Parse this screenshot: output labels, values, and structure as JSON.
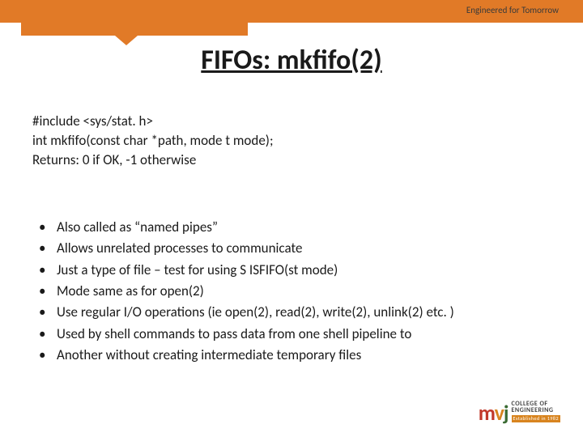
{
  "header": {
    "tagline": "Engineered for Tomorrow"
  },
  "title": "FIFOs: mkfifo(2)",
  "code": {
    "line1": "#include <sys/stat. h>",
    "line2": "int mkfifo(const char *path, mode t mode);",
    "line3": "Returns: 0 if OK, -1 otherwise"
  },
  "bullets": [
    "Also called as “named pipes”",
    "Allows unrelated processes to communicate",
    "Just a type of file – test for using S ISFIFO(st mode)",
    "Mode same as for open(2)",
    "Use regular I/O operations (ie open(2), read(2), write(2), unlink(2) etc. )",
    "Used by shell commands to pass data from one shell pipeline to",
    "Another without creating intermediate temporary files"
  ],
  "logo": {
    "mark_m": "m",
    "mark_v": "v",
    "mark_j": "j",
    "line1": "COLLEGE OF",
    "line2": "ENGINEERING",
    "est": "Established in 1982"
  }
}
